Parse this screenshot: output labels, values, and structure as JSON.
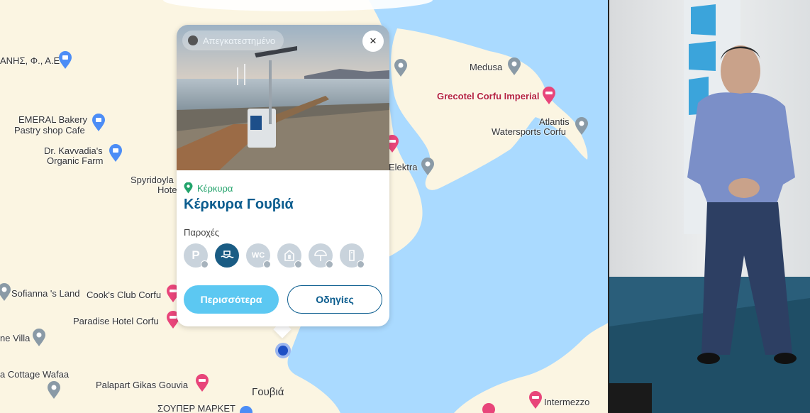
{
  "map": {
    "places": {
      "gouvia": "Γουβιά"
    },
    "pois": {
      "anis": "ΑΝΗΣ, Φ., Α.Ε",
      "emeral_1": "EMERAL Bakery",
      "emeral_2": "Pastry shop Cafe",
      "kavvadia_1": "Dr. Kavvadia's",
      "kavvadia_2": "Organic Farm",
      "spyridoyla_1": "Spyridoyla",
      "spyridoyla_2": "Hotel",
      "medusa": "Medusa",
      "grecotel": "Grecotel Corfu Imperial",
      "atlantis_1": "Atlantis",
      "atlantis_2": "Watersports Corfu",
      "elektra": "Elektra",
      "sofianna": "Sofianna 's Land",
      "cooks": "Cook's Club Corfu",
      "paradise": "Paradise Hotel Corfu",
      "villa": "ne Villa",
      "cottage": "a Cottage Wafaa",
      "palapart": "Palapart Gikas Gouvia",
      "market": "ΣΟΥΠΕΡ ΜΑΡΚΕΤ",
      "intermezzo": "Intermezzo"
    }
  },
  "card": {
    "status": "Απεγκατεστημένο",
    "close_icon": "×",
    "location": "Κέρκυρα",
    "title": "Κέρκυρα Γουβιά",
    "amenities_label": "Παροχές",
    "amenities": [
      {
        "icon": "parking-icon",
        "glyph": "P",
        "active": false
      },
      {
        "icon": "seatrac-icon",
        "glyph": "",
        "active": true
      },
      {
        "icon": "wc-icon",
        "glyph": "WC",
        "active": false
      },
      {
        "icon": "changing-room-icon",
        "glyph": "",
        "active": false
      },
      {
        "icon": "umbrella-icon",
        "glyph": "",
        "active": false
      },
      {
        "icon": "shower-icon",
        "glyph": "",
        "active": false
      }
    ],
    "more_button": "Περισσότερα",
    "directions_button": "Οδηγίες"
  },
  "colors": {
    "brand_dark": "#0a5c8e",
    "brand_light": "#5cc8f2",
    "location_green": "#22a36b",
    "sea": "#aadaff",
    "land": "#fbf5e2"
  }
}
